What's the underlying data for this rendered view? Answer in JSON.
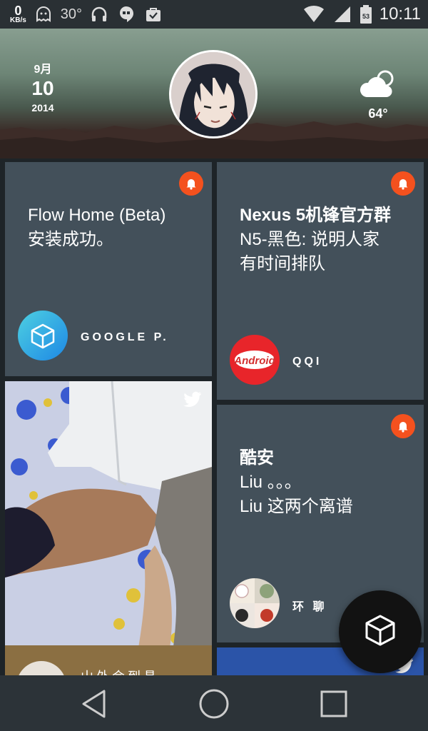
{
  "statusbar": {
    "speed_value": "0",
    "speed_unit": "KB/s",
    "temperature": "30°",
    "icons": [
      "ghost-icon",
      "headphones-icon",
      "hangouts-icon",
      "shopping-bag-icon"
    ],
    "right_icons": [
      "wifi-icon",
      "signal-icon",
      "battery-icon"
    ],
    "battery_level": "53",
    "time": "10:11"
  },
  "header": {
    "month": "9月",
    "day": "10",
    "year": "2014",
    "weather_icon": "cloud-sun-icon",
    "temperature": "64°"
  },
  "cards": [
    {
      "title": "Flow Home (Beta)",
      "body": "安装成功。",
      "app_label": "GOOGLE P.",
      "app_icon": "package-cube-icon",
      "badge": "bell-icon"
    },
    {
      "title": "Nexus 5机锋官方群",
      "body_lines": [
        "N5-黑色: 说明人家",
        "有时间排队"
      ],
      "app_label": "QQI",
      "app_icon": "android-logo-icon",
      "badge": "bell-icon"
    },
    {
      "title": "酷安",
      "body_lines": [
        "Liu  。。。",
        "Liu  这两个离谱"
      ],
      "app_label": "环 聊",
      "app_icon": "group-avatar-icon",
      "badge": "bell-icon"
    }
  ],
  "photo_cards": [
    {
      "source": "twitter-icon",
      "caption": "山外会到具"
    },
    {
      "source": "twitter-icon"
    }
  ],
  "colors": {
    "card_bg": "#43505a",
    "badge_orange": "#f4511e",
    "statusbar_bg": "#2a3034",
    "navbar_bg": "#2c3338"
  },
  "navbar": {
    "back": "back-triangle-icon",
    "home": "home-circle-icon",
    "recents": "recents-square-icon"
  },
  "fab_icon": "cube-icon"
}
